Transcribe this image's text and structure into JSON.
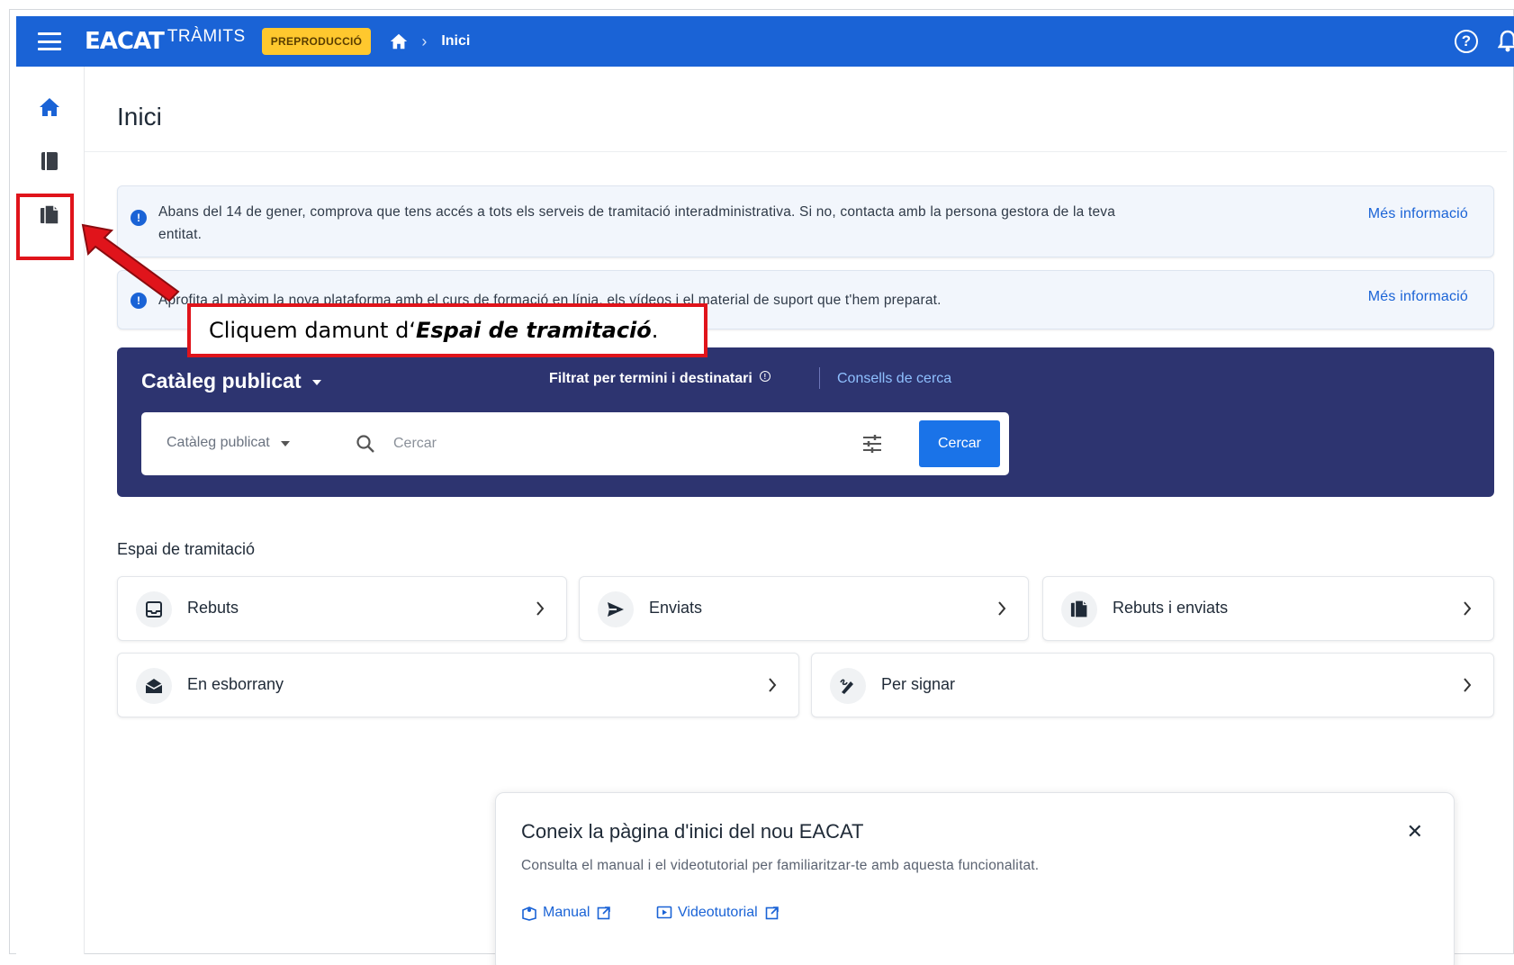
{
  "topbar": {
    "logo": "EACAT",
    "logo_suffix": "TRÀMITS",
    "env_badge": "PREPRODUCCIÓ",
    "breadcrumb_current": "Inici",
    "help_glyph": "?"
  },
  "page": {
    "title": "Inici"
  },
  "alerts": [
    {
      "text_line1": "Abans del 14 de gener, comprova que tens accés a tots els serveis de tramitació interadministrativa. Si no, contacta amb la persona gestora de la teva",
      "text_line2": "entitat.",
      "link": "Més informació"
    },
    {
      "text": "Aprofita al màxim la nova plataforma amb el curs de formació en línia, els vídeos i el material de suport que t'hem preparat.",
      "link": "Més informació"
    }
  ],
  "catalog": {
    "title": "Catàleg publicat",
    "filter_text": "Filtrat per termini i destinatari",
    "filter_info_glyph": "!",
    "search_tips": "Consells de cerca",
    "scope_value": "Catàleg publicat",
    "search_placeholder": "Cercar",
    "search_button": "Cercar"
  },
  "espai": {
    "section_label": "Espai de tramitació",
    "cards": [
      {
        "label": "Rebuts",
        "icon": "inbox-icon"
      },
      {
        "label": "Enviats",
        "icon": "send-icon"
      },
      {
        "label": "Rebuts i enviats",
        "icon": "documents-icon"
      },
      {
        "label": "En esborrany",
        "icon": "draft-mail-icon"
      },
      {
        "label": "Per signar",
        "icon": "signature-icon"
      }
    ]
  },
  "popover": {
    "title": "Coneix la pàgina d'inici del nou EACAT",
    "close_glyph": "✕",
    "description": "Consulta el manual i el videotutorial per familiaritzar-te amb aquesta funcionalitat.",
    "manual_link": "Manual",
    "video_link": "Videotutorial"
  },
  "annotation": {
    "callout_prefix": "Cliquem damunt d‘",
    "callout_emphasis": "Espai de tramitació",
    "callout_suffix": ".",
    "highlight_color": "#e0141b"
  },
  "colors": {
    "brand_blue": "#1a63d6",
    "catalog_navy": "#2d3470",
    "badge_yellow": "#ffc82e"
  }
}
